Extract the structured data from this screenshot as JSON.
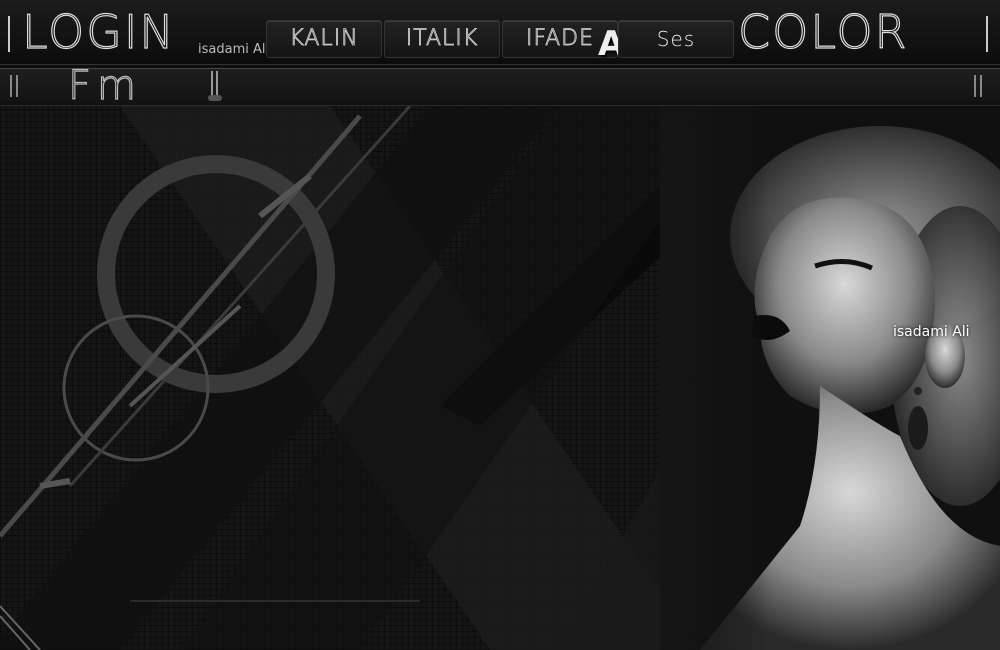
{
  "header": {
    "login_label": "LOGIN",
    "color_label": "COLOR",
    "signature": "isadami Ali"
  },
  "toolbar": {
    "bold_label": "KALIN",
    "italic_label": "ITALIK",
    "emote_label": "IFADE",
    "font_icon": "A",
    "sound_label": "Ses"
  },
  "radio": {
    "label": "Fm"
  },
  "stage": {
    "portrait_signature": "isadami Ali"
  }
}
